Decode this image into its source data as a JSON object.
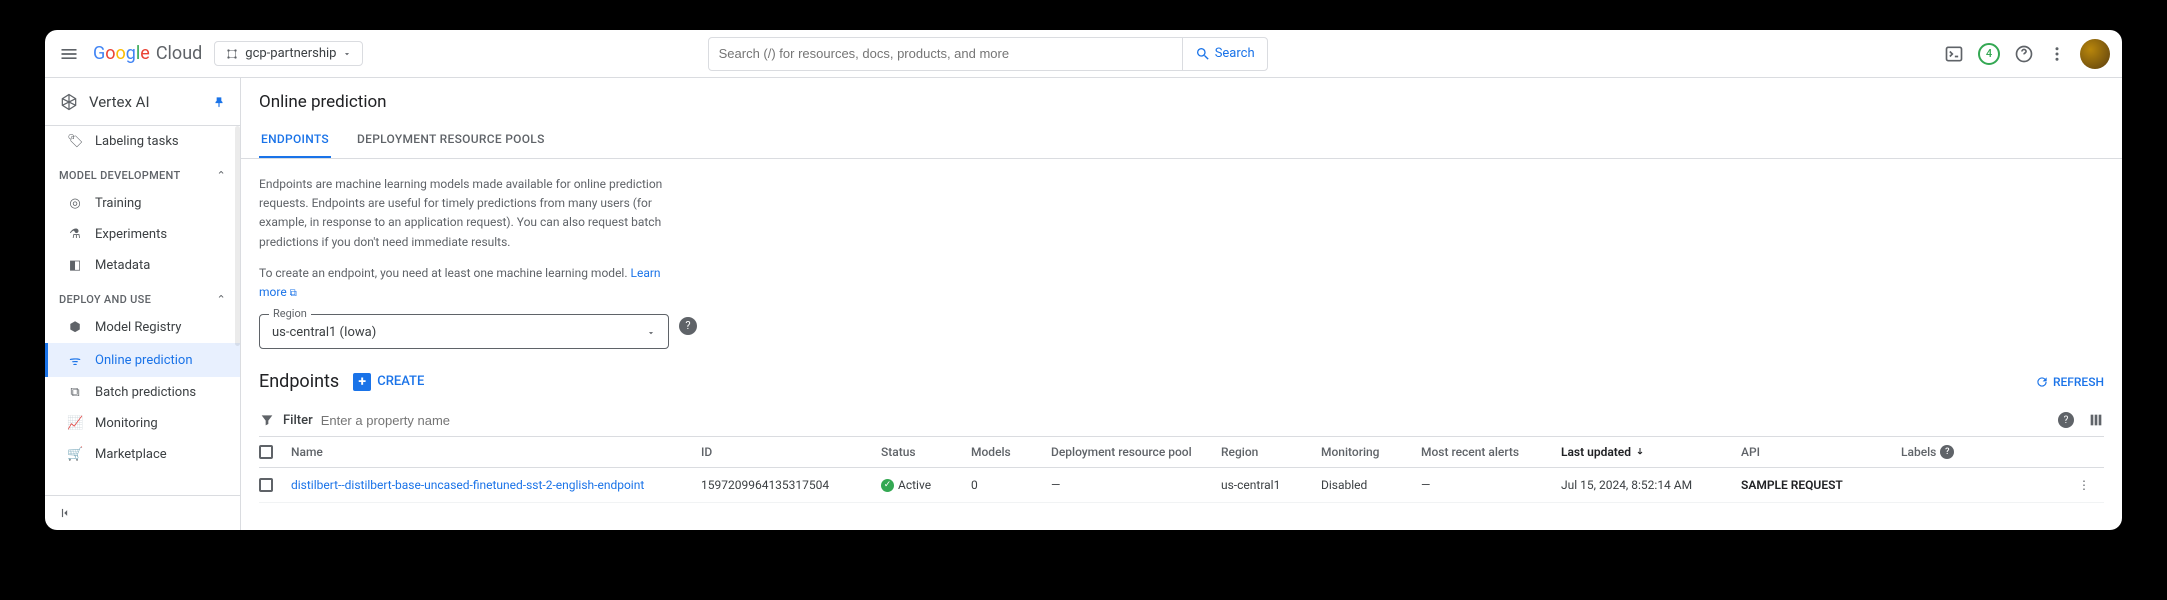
{
  "header": {
    "project": "gcp-partnership",
    "search_placeholder": "Search (/) for resources, docs, products, and more",
    "search_button": "Search",
    "notification_count": "4",
    "logo_cloud": "Cloud"
  },
  "sidebar": {
    "product": "Vertex AI",
    "items": {
      "labeling": "Labeling tasks",
      "section_model_dev": "MODEL DEVELOPMENT",
      "training": "Training",
      "experiments": "Experiments",
      "metadata": "Metadata",
      "section_deploy": "DEPLOY AND USE",
      "model_registry": "Model Registry",
      "online_prediction": "Online prediction",
      "batch_predictions": "Batch predictions",
      "monitoring": "Monitoring",
      "marketplace": "Marketplace"
    }
  },
  "page": {
    "title": "Online prediction",
    "tabs": {
      "endpoints": "ENDPOINTS",
      "pools": "DEPLOYMENT RESOURCE POOLS"
    },
    "description1": "Endpoints are machine learning models made available for online prediction requests. Endpoints are useful for timely predictions from many users (for example, in response to an application request). You can also request batch predictions if you don't need immediate results.",
    "description2": "To create an endpoint, you need at least one machine learning model.",
    "learn_more": "Learn more",
    "region_label": "Region",
    "region_value": "us-central1 (Iowa)",
    "section_title": "Endpoints",
    "create": "CREATE",
    "refresh": "REFRESH",
    "filter_label": "Filter",
    "filter_placeholder": "Enter a property name"
  },
  "table": {
    "headers": {
      "name": "Name",
      "id": "ID",
      "status": "Status",
      "models": "Models",
      "pool": "Deployment resource pool",
      "region": "Region",
      "monitoring": "Monitoring",
      "alerts": "Most recent alerts",
      "last_updated": "Last updated",
      "api": "API",
      "labels": "Labels"
    },
    "row": {
      "name": "distilbert--distilbert-base-uncased-finetuned-sst-2-english-endpoint",
      "id": "1597209964135317504",
      "status": "Active",
      "models": "0",
      "pool": "—",
      "region": "us-central1",
      "monitoring": "Disabled",
      "alerts": "—",
      "last_updated": "Jul 15, 2024, 8:52:14 AM",
      "api": "SAMPLE REQUEST"
    }
  }
}
